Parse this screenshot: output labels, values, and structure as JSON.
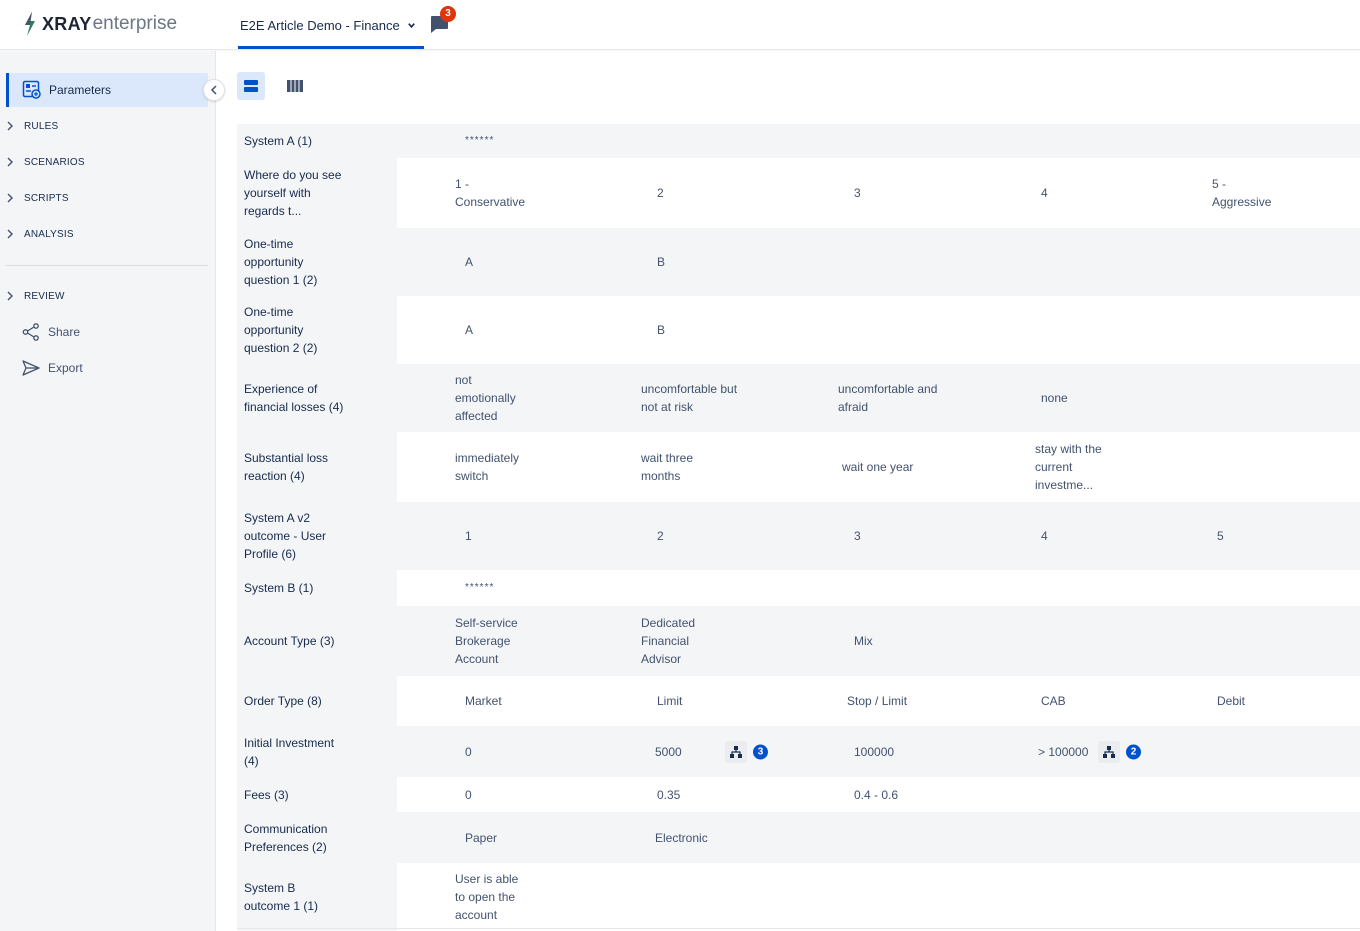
{
  "header": {
    "logo_bold": "XRAY",
    "logo_light": "enterprise",
    "project_name": "E2E Article Demo - Finance",
    "notification_count": "3"
  },
  "sidebar": {
    "active_item": "Parameters",
    "groups": [
      "RULES",
      "SCENARIOS",
      "SCRIPTS",
      "ANALYSIS"
    ],
    "review_label": "REVIEW",
    "share_label": "Share",
    "export_label": "Export"
  },
  "parameters": [
    {
      "name": "System A (1)",
      "values": [
        "******"
      ]
    },
    {
      "name": "Where do you see yourself with regards t...",
      "values": [
        "1 - Conservative",
        "2",
        "3",
        "4",
        "5 - Aggressive"
      ]
    },
    {
      "name": "One-time opportunity question 1 (2)",
      "values": [
        "A",
        "B"
      ]
    },
    {
      "name": "One-time opportunity question 2 (2)",
      "values": [
        "A",
        "B"
      ]
    },
    {
      "name": "Experience of financial losses (4)",
      "values": [
        "not emotionally affected",
        "uncomfortable but not at risk",
        "uncomfortable and afraid",
        "none"
      ]
    },
    {
      "name": "Substantial loss reaction (4)",
      "values": [
        "immediately switch",
        "wait three months",
        "wait one year",
        "stay with the current investme..."
      ]
    },
    {
      "name": "System A v2 outcome - User Profile (6)",
      "values": [
        "1",
        "2",
        "3",
        "4",
        "5"
      ]
    },
    {
      "name": "System B (1)",
      "values": [
        "******"
      ]
    },
    {
      "name": "Account Type (3)",
      "values": [
        "Self-service Brokerage Account",
        "Dedicated Financial Advisor",
        "Mix"
      ]
    },
    {
      "name": "Order Type (8)",
      "values": [
        "Market",
        "Limit",
        "Stop / Limit",
        "CAB",
        "Debit"
      ]
    },
    {
      "name": "Initial Investment (4)",
      "values": [
        "0",
        "5000",
        "100000",
        "> 100000"
      ],
      "badges": [
        "3",
        "2"
      ]
    },
    {
      "name": "Fees (3)",
      "values": [
        "0",
        "0.35",
        "0.4 - 0.6"
      ]
    },
    {
      "name": "Communication Preferences (2)",
      "values": [
        "Paper",
        "Electronic"
      ]
    },
    {
      "name": "System B outcome 1 (1)",
      "values": [
        "User is able to open the account"
      ]
    }
  ],
  "colors": {
    "accent": "#0052cc",
    "badge_red": "#de350b",
    "sidebar_bg": "#f4f5f7",
    "active_bg": "#dbe7fb"
  }
}
